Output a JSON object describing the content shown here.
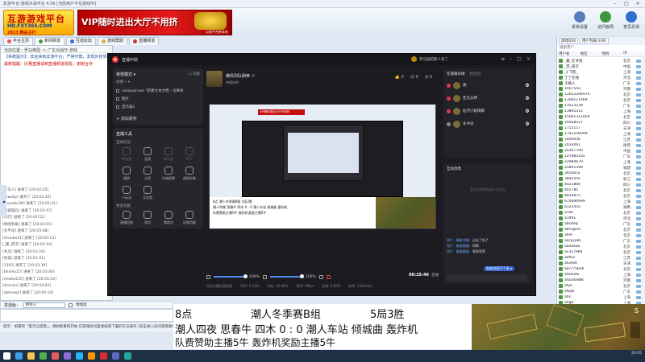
{
  "window": {
    "title": "友游平台-游戏对战平台 4.56 [当前用户不在游戏中]"
  },
  "banner": {
    "logo_line1": "互游游戏平台",
    "logo_line2": "HD.FXT365.COM",
    "logo_line3": "2013 精品主打",
    "vip_text": "VIP随时进出大厅不用挤",
    "vip_sub": "以前平台新体验"
  },
  "top_buttons": [
    {
      "label": "系统设置",
      "color": "#5a7fb8"
    },
    {
      "label": "访问官网",
      "color": "#3a9a3a"
    },
    {
      "label": "意见反馈",
      "color": "#2f6fcf"
    }
  ],
  "tabs": [
    {
      "label": "平台主页"
    },
    {
      "label": "新闻频道"
    },
    {
      "label": "互动论坛"
    },
    {
      "label": "游戏帮助"
    },
    {
      "label": "直播频道"
    }
  ],
  "chat": {
    "header": "当前位置：罗马帝国 -> 广东对战厅-游戏",
    "notices": [
      {
        "text": "【系统提示】：欢迎来到友游平台，严禁作弊，发现外挂举报",
        "style": "b"
      },
      {
        "text": "最新提醒：比赛直播请到直播频道观看，谢谢合作",
        "style": "r"
      }
    ],
    "log": [
      "[罗马人] 进来了 [20:02:35]",
      "[rhweby] 离开了 [20:02:40]",
      "[zhasabc38] 进来了 [20:02:41]",
      "[迷城骑兵] 进来了 [20:02:47]",
      "[风行] 进来了 [20:02:52]",
      "[地图有爱] 进来了 [20:03:01]",
      "[太平洋] 进来了 [20:03:08]",
      "[shunbe21] 进来了 [20:03:13]",
      "[_聚_转子] 进来了 [20:03:19]",
      "[木瓜] 进来了 [20:03:24]",
      "[阿美] 进来了 [20:03:31]",
      "[1392] 离开了 [20:03:39]",
      "[bheiho25] 进来了 [20:03:46]",
      "[chwho235] 进来了 [20:03:53]",
      "[zhenhu] 进来了 [20:04:02]",
      "[abbrewh] 进来了 [20:04:10]"
    ]
  },
  "input_row": {
    "label": "发送给：",
    "target_value": "所有人",
    "checkbox_label": "悄悄话"
  },
  "tip_bar": "提示：如遇到「提示已结束」，请刷新重新开始 在游戏房间里请按照下面的方法操作 [双击进入房间或者联系管理员]",
  "user_panel": {
    "tabs": [
      "游戏房间",
      "用户列表(106)"
    ],
    "search_label": "搜索用户：",
    "columns": [
      "用户名",
      "地区",
      "性别",
      "IP"
    ],
    "users": [
      {
        "name": "_聚_在寻找",
        "region": "北京"
      },
      {
        "name": "_苏_丽子",
        "region": "中国"
      },
      {
        "name": "_1飞雪_",
        "region": "上海"
      },
      {
        "name": "丁丁在线",
        "region": "河北"
      },
      {
        "name": "于嫣人",
        "region": "广东"
      },
      {
        "name": "1467543",
        "region": "河南"
      },
      {
        "name": "13052296974",
        "region": "北京"
      },
      {
        "name": "1308111469",
        "region": "北京"
      },
      {
        "name": "13523239",
        "region": "广东"
      },
      {
        "name": "13892312",
        "region": "上海"
      },
      {
        "name": "15041311059",
        "region": "北京"
      },
      {
        "name": "16958537",
        "region": "四川"
      },
      {
        "name": "1755117",
        "region": "天津"
      },
      {
        "name": "1791556099",
        "region": "上海"
      },
      {
        "name": "1809456",
        "region": "江苏"
      },
      {
        "name": "2033061",
        "region": "陕西"
      },
      {
        "name": "20367700",
        "region": "中国"
      },
      {
        "name": "227882102",
        "region": "广东"
      },
      {
        "name": "22984670",
        "region": "上海"
      },
      {
        "name": "25841398",
        "region": "福建"
      },
      {
        "name": "365docu",
        "region": "北京"
      },
      {
        "name": "3842555",
        "region": "浙江"
      },
      {
        "name": "4021800",
        "region": "四川"
      },
      {
        "name": "465785",
        "region": "北京"
      },
      {
        "name": "4832875",
        "region": "北京"
      },
      {
        "name": "670690999",
        "region": "上海"
      },
      {
        "name": "a12345a",
        "region": "湖南"
      },
      {
        "name": "a1an",
        "region": "北京"
      },
      {
        "name": "a1991",
        "region": "河北"
      },
      {
        "name": "abcdeq",
        "region": "广东"
      },
      {
        "name": "abcrgoro",
        "region": "北京"
      },
      {
        "name": "a6m",
        "region": "北京"
      },
      {
        "name": "aaryyy81",
        "region": "广东"
      },
      {
        "name": "aaaaaaa",
        "region": "北京"
      },
      {
        "name": "ac317968",
        "region": "北京"
      },
      {
        "name": "adf03",
        "region": "江苏"
      },
      {
        "name": "ae2f89",
        "region": "天津"
      },
      {
        "name": "aer775826",
        "region": "北京"
      },
      {
        "name": "afadudu",
        "region": "上海"
      },
      {
        "name": "afaas6888",
        "region": "河南"
      },
      {
        "name": "afyo",
        "region": "北京"
      },
      {
        "name": "afwjb",
        "region": "广东"
      },
      {
        "name": "ahs",
        "region": "上海"
      },
      {
        "name": "ahgb",
        "region": "上海"
      },
      {
        "name": "ahpo",
        "region": "北京"
      },
      {
        "name": "ahgj88",
        "region": "北京"
      },
      {
        "name": "ahr10",
        "region": "四川"
      },
      {
        "name": "aipao",
        "region": "北京"
      },
      {
        "name": "aizsoi",
        "region": "北京"
      },
      {
        "name": "aipos",
        "region": "上海"
      }
    ]
  },
  "streamer": {
    "app_title": "直播中助",
    "host_name": "罗马园的斯人老二",
    "profile_name": "佛风烈队刷帝 ☉",
    "profile_sub": "带帽的吧",
    "stats": [
      "0",
      "0",
      "0"
    ],
    "scene_card": {
      "title": "常规模式 ▾",
      "action": "☐ 切屏",
      "subtitle": "场景一 ▾"
    },
    "sources": [
      "notepad.exe \"新建文本文档 - 记事本",
      "图片",
      "显示器1"
    ],
    "add_label": "+ 添加素材",
    "tools_title": "直播工具",
    "tools_sub": "互动玩法",
    "tools": [
      {
        "label": "PK连麦",
        "dim": true
      },
      {
        "label": "连线",
        "dim": false
      },
      {
        "label": "聊天室",
        "dim": true
      },
      {
        "label": "KTV",
        "dim": true
      },
      {
        "label": "福袋",
        "dim": false
      },
      {
        "label": "心愿",
        "dim": false
      },
      {
        "label": "礼物投票",
        "dim": false
      },
      {
        "label": "虚拟形象",
        "dim": false
      },
      {
        "label": "小玩法",
        "dim": false
      },
      {
        "label": "互动游",
        "dim": false
      }
    ],
    "more_title": "更多功能",
    "more_tools": [
      {
        "label": "直播回放"
      },
      {
        "label": "背包"
      },
      {
        "label": "管理员"
      },
      {
        "label": "店铺功能"
      }
    ],
    "preview": {
      "ad": "VIP随时进出大厅不用挤",
      "lines": [
        "8点            潮人冬季赛B组          5局3胜",
        "潮人四夜 思春牛  四木 0 : 0  潮人车站 倾城曲 轰炸机",
        "队费赞助主播5牛      轰炸机奖励主播5牛"
      ]
    },
    "controls": {
      "mic_pct": "100%",
      "spk_pct": "100%",
      "time": "00:25:46",
      "live": "直播"
    },
    "status": [
      "开启主播记录音频",
      "CPU: 2.13%",
      "内存: 36.60%",
      "帧率: 30fps",
      "丢帧: 0.00%",
      "码率: 1341kb/s"
    ],
    "audience": {
      "tab_online": "在线观众榜",
      "tab_fans": "粉丝团",
      "rows": [
        {
          "name": "嵩",
          "score": "0"
        },
        {
          "name": "亚古兵神",
          "score": "0"
        },
        {
          "name": "仙河小碰御群",
          "score": "0"
        },
        {
          "name": "冬冲天",
          "score": "0"
        }
      ]
    },
    "interaction": {
      "title": "互动消息",
      "hint": "暂无不错你能展示到此处",
      "messages": [
        {
          "user": "用户 · 靓崽龙服：",
          "text": "出去了哇了"
        },
        {
          "user": "用户 · 靓崽靓服：",
          "text": "四啊"
        },
        {
          "user": "用户 · 靓崽靓服：",
          "text": "哥哥哥哥"
        }
      ],
      "badge": "有新消息277 条 ▾"
    }
  },
  "overlay": {
    "r1_a": "8点",
    "r1_b": "潮人冬季赛B组",
    "r1_c": "5局3胜",
    "r2": "潮人四夜 思春牛 四木 0 :  0  潮人车站 倾城曲 轰炸机",
    "r3": "队费赞助主播5牛       轰炸机奖励主播5牛"
  },
  "gamemap": {
    "label": "S"
  },
  "taskbar": {
    "icons": [
      "#ffffff",
      "#3aa1e8",
      "#f2c94c",
      "#4caf50",
      "#e35d5d",
      "#8e6cd9",
      "#29b6f6",
      "#ff9800",
      "#d32f2f",
      "#5c6bc0",
      "#26a69a"
    ],
    "clock": "20:05"
  }
}
